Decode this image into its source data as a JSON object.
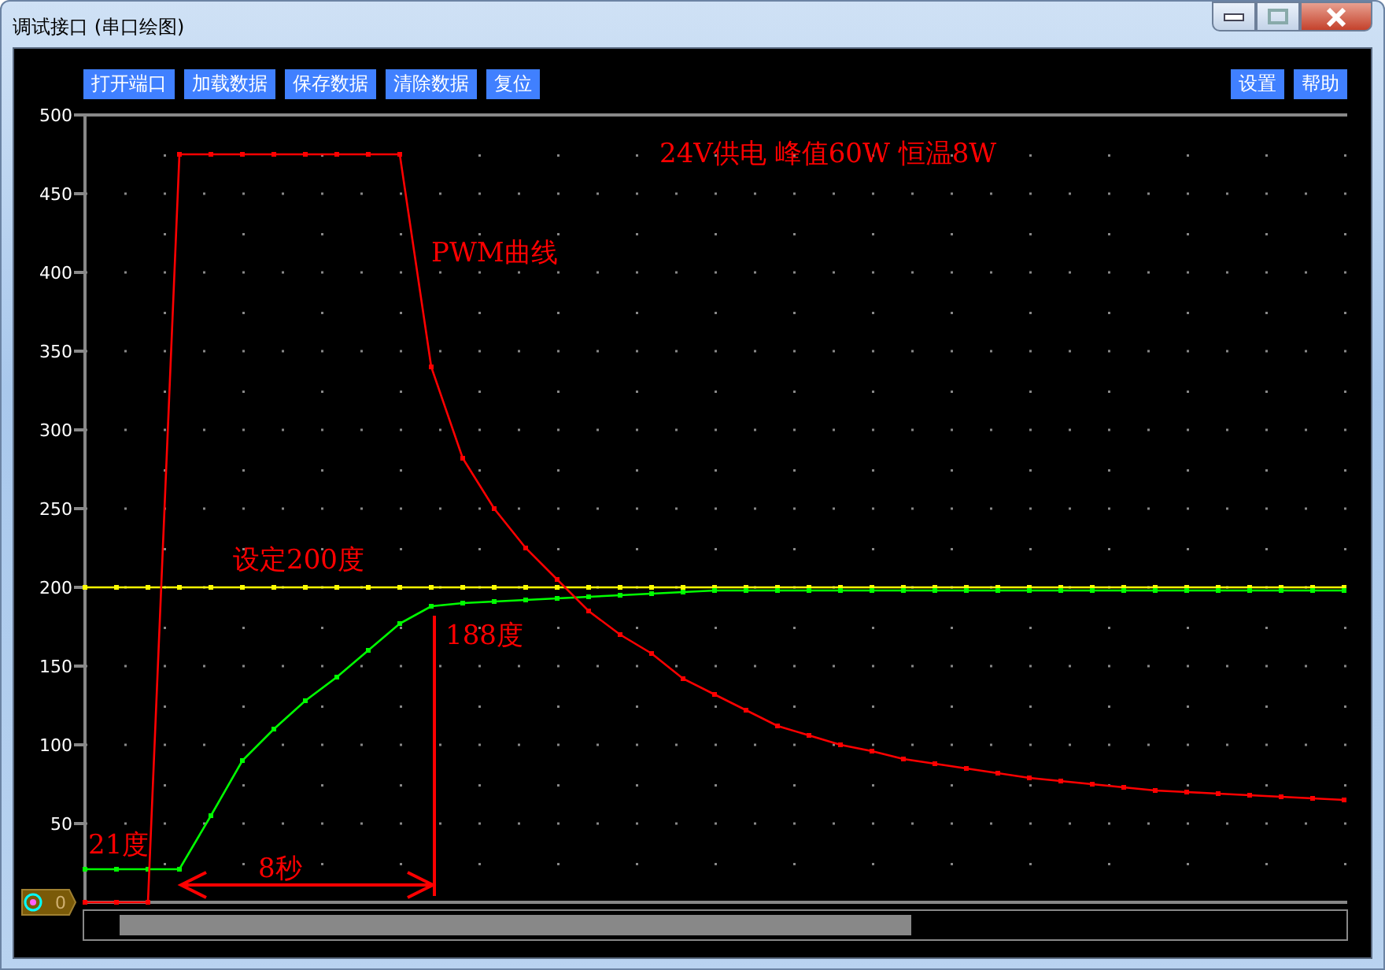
{
  "window": {
    "title": "调试接口 (串口绘图)"
  },
  "toolbar_left": [
    "打开端口",
    "加载数据",
    "保存数据",
    "清除数据",
    "复位"
  ],
  "toolbar_right": [
    "设置",
    "帮助"
  ],
  "chart": {
    "chart_data": {
      "type": "line",
      "categories": [
        null,
        null,
        null,
        null,
        null,
        null,
        null,
        null,
        null,
        null,
        null,
        null,
        null,
        null,
        null,
        null,
        null,
        null,
        null,
        null,
        null,
        null,
        null,
        null,
        null,
        null,
        null,
        null,
        null,
        null,
        null,
        null,
        null,
        null,
        null,
        null,
        null,
        null,
        null,
        null,
        null
      ],
      "series": [
        {
          "color": "#ff0000",
          "values": [
            0,
            0,
            0,
            475,
            475,
            475,
            475,
            475,
            475,
            475,
            475,
            340,
            282,
            250,
            225,
            205,
            185,
            170,
            158,
            142,
            132,
            122,
            112,
            106,
            100,
            96,
            91,
            88,
            85,
            82,
            79,
            77,
            75,
            73,
            71,
            70,
            69,
            68,
            67,
            66,
            65
          ]
        },
        {
          "color": "#00ff00",
          "values": [
            21,
            21,
            21,
            21,
            55,
            90,
            110,
            128,
            143,
            160,
            177,
            188,
            190,
            191,
            192,
            193,
            194,
            195,
            196,
            197,
            198,
            198,
            198,
            198,
            198,
            198,
            198,
            198,
            198,
            198,
            198,
            198,
            198,
            198,
            198,
            198,
            198,
            198,
            198,
            198,
            198
          ]
        },
        {
          "color": "#ffff00",
          "values": [
            200,
            200,
            200,
            200,
            200,
            200,
            200,
            200,
            200,
            200,
            200,
            200,
            200,
            200,
            200,
            200,
            200,
            200,
            200,
            200,
            200,
            200,
            200,
            200,
            200,
            200,
            200,
            200,
            200,
            200,
            200,
            200,
            200,
            200,
            200,
            200,
            200,
            200,
            200,
            200,
            200
          ]
        }
      ],
      "grid": true,
      "ylim": [
        0,
        500
      ],
      "yticks": [
        50,
        100,
        150,
        200,
        250,
        300,
        350,
        400,
        450,
        500
      ]
    },
    "labels": [
      "24V供电 峰值60W 恒温8W",
      "PWM曲线",
      "设定200度",
      "188度",
      "21度",
      "8秒"
    ]
  },
  "badge": {
    "value": "0"
  }
}
